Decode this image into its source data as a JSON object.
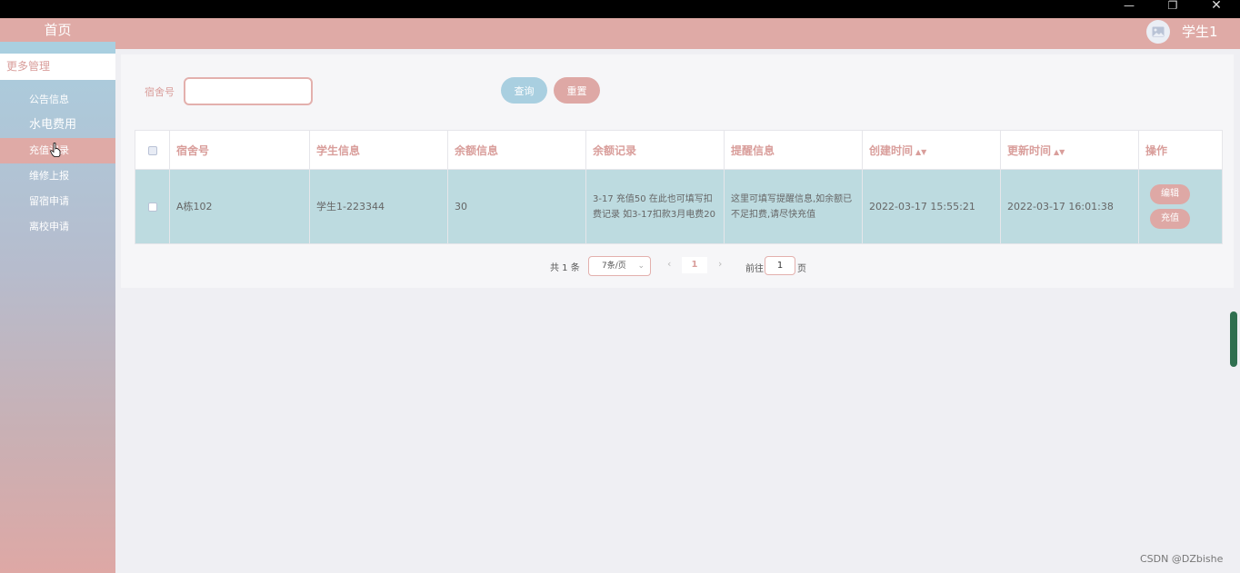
{
  "window": {
    "min": "—",
    "max": "❐",
    "close": "✕"
  },
  "sidebar": {
    "home": "首页",
    "group": "更多管理",
    "items": [
      {
        "label": "公告信息"
      },
      {
        "label": "水电费用"
      },
      {
        "label": "充值记录"
      },
      {
        "label": "维修上报"
      },
      {
        "label": "留宿申请"
      },
      {
        "label": "离校申请"
      }
    ]
  },
  "header": {
    "username": "学生1"
  },
  "search": {
    "label": "宿舍号",
    "value": "",
    "query_btn": "查询",
    "reset_btn": "重置"
  },
  "table": {
    "headers": [
      "宿舍号",
      "学生信息",
      "余额信息",
      "余额记录",
      "提醒信息",
      "创建时间",
      "更新时间",
      "操作"
    ],
    "rows": [
      {
        "dorm": "A栋102",
        "student": "学生1-223344",
        "balance": "30",
        "record": "3-17 充值50 在此也可填写扣费记录 如3-17扣款3月电费20",
        "remind": "这里可填写提醒信息,如余额已不足扣费,请尽快充值",
        "created": "2022-03-17 15:55:21",
        "updated": "2022-03-17 16:01:38",
        "edit": "编辑",
        "recharge": "充值"
      }
    ]
  },
  "pagination": {
    "total": "共 1 条",
    "page_size": "7条/页",
    "current": "1",
    "goto": "前往",
    "goto_value": "1",
    "page_suffix": "页"
  },
  "watermark": "CSDN @DZbishe",
  "colors": {
    "pink": "#dfaaa6",
    "blue": "#a9cfe0",
    "row": "#bddbe0"
  }
}
